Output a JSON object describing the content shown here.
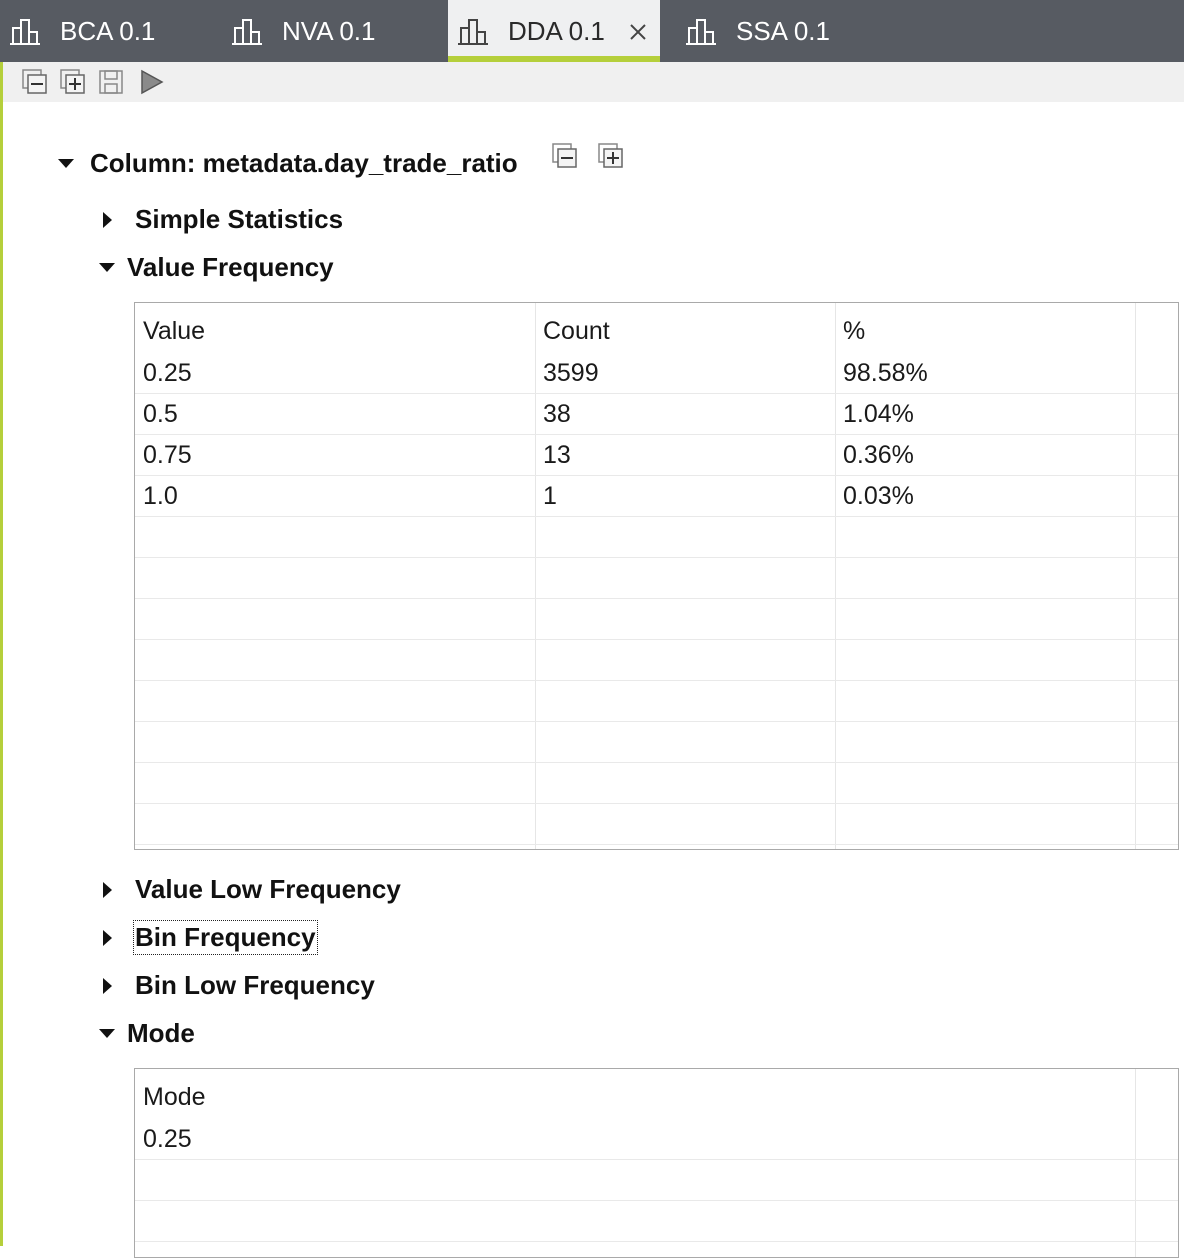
{
  "tabs": [
    {
      "label": "BCA 0.1",
      "active": false
    },
    {
      "label": "NVA 0.1",
      "active": false
    },
    {
      "label": "DDA 0.1",
      "active": true
    },
    {
      "label": "SSA 0.1",
      "active": false
    }
  ],
  "toolbar": {
    "buttons": [
      "collapse-all",
      "expand-all",
      "save",
      "run"
    ]
  },
  "tree": {
    "column_label": "Column: metadata.day_trade_ratio",
    "sections": {
      "simple_statistics": "Simple Statistics",
      "value_frequency": "Value Frequency",
      "value_low_frequency": "Value Low Frequency",
      "bin_frequency": "Bin Frequency",
      "bin_low_frequency": "Bin Low Frequency",
      "mode": "Mode"
    }
  },
  "value_frequency_table": {
    "headers": [
      "Value",
      "Count",
      "%"
    ],
    "rows": [
      [
        "0.25",
        "3599",
        "98.58%"
      ],
      [
        "0.5",
        "38",
        "1.04%"
      ],
      [
        "0.75",
        "13",
        "0.36%"
      ],
      [
        "1.0",
        "1",
        "0.03%"
      ]
    ]
  },
  "mode_table": {
    "header": "Mode",
    "rows": [
      "0.25"
    ]
  },
  "colors": {
    "tabbar_bg": "#575b62",
    "active_tab_bg": "#eff0f1",
    "accent": "#b5cf3b"
  }
}
